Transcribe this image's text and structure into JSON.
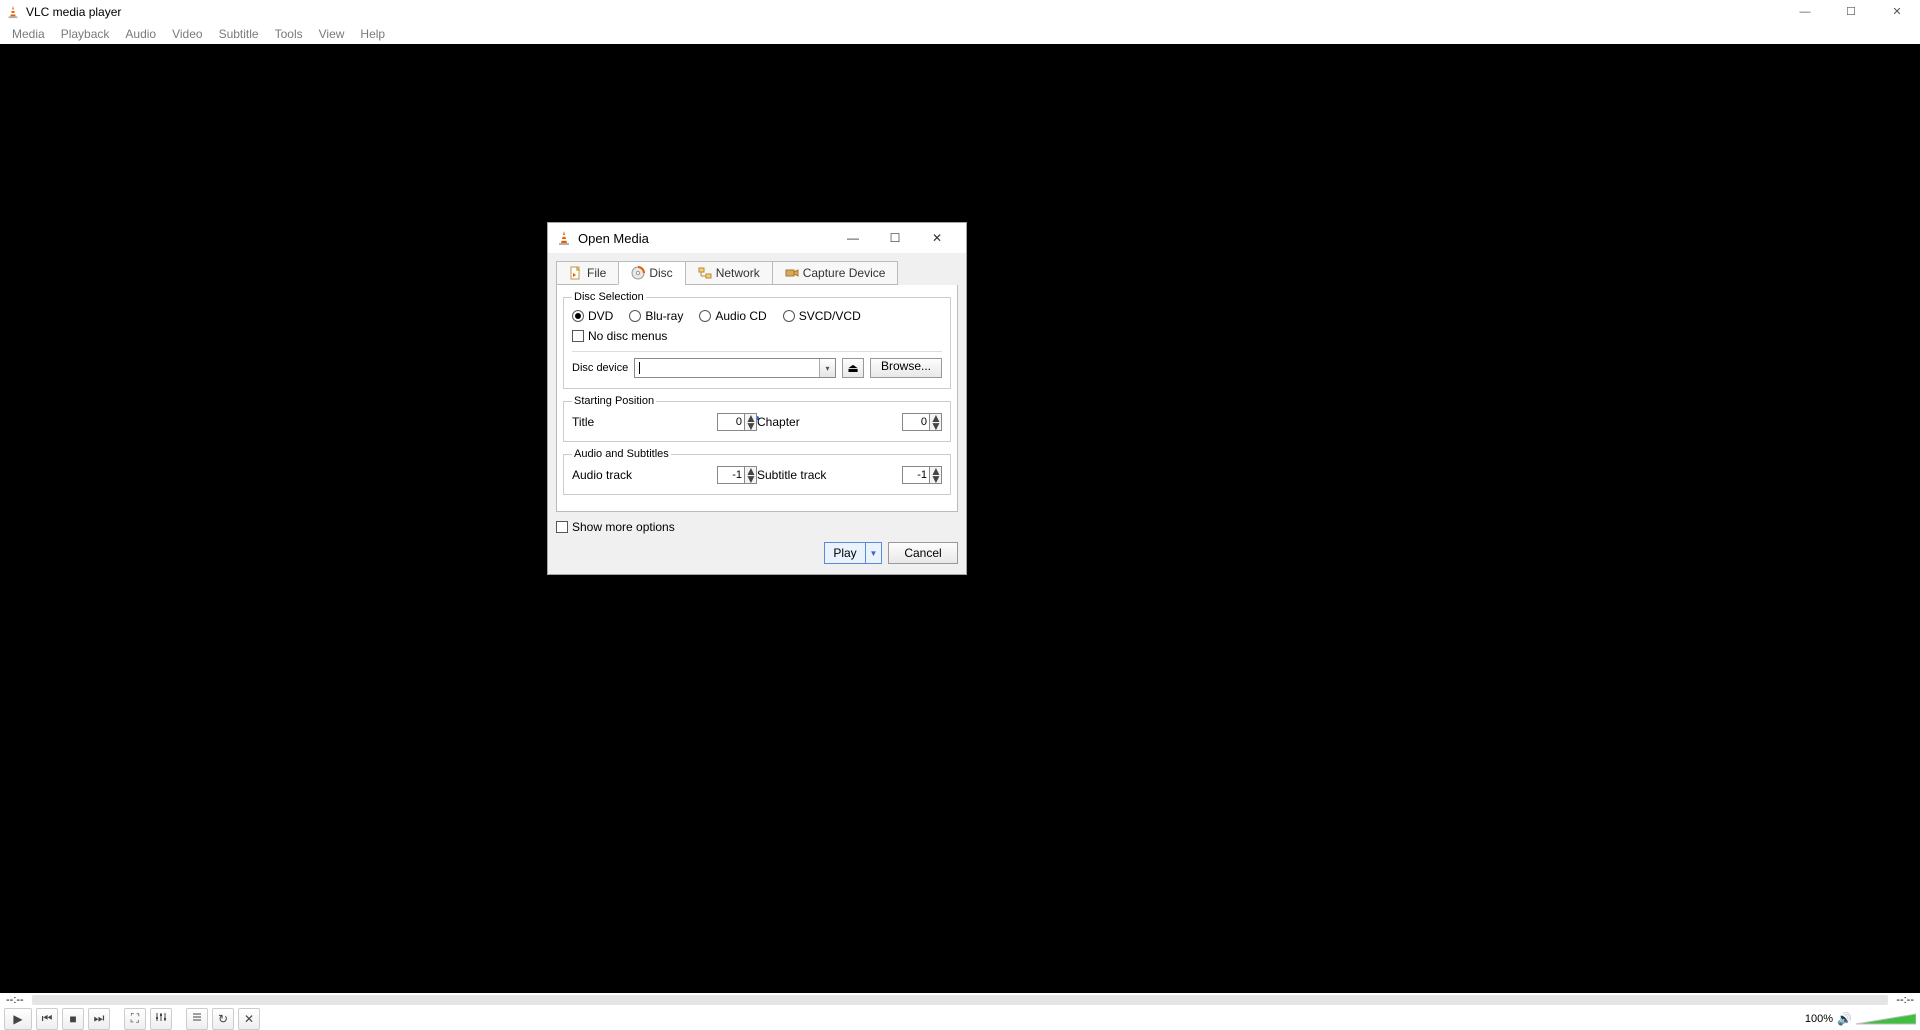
{
  "window": {
    "title": "VLC media player"
  },
  "menu": [
    "Media",
    "Playback",
    "Audio",
    "Video",
    "Subtitle",
    "Tools",
    "View",
    "Help"
  ],
  "seek": {
    "left": "--:--",
    "right": "--:--"
  },
  "volume": {
    "label": "100%"
  },
  "dialog": {
    "title": "Open Media",
    "tabs": {
      "file": "File",
      "disc": "Disc",
      "network": "Network",
      "capture": "Capture Device"
    },
    "disc_selection": {
      "legend": "Disc Selection",
      "dvd": "DVD",
      "bluray": "Blu-ray",
      "audiocd": "Audio CD",
      "svcd": "SVCD/VCD",
      "no_menus": "No disc menus",
      "device_label": "Disc device",
      "device_value": "",
      "browse": "Browse..."
    },
    "starting": {
      "legend": "Starting Position",
      "title_label": "Title",
      "title_value": "0",
      "chapter_label": "Chapter",
      "chapter_value": "0"
    },
    "audiosubs": {
      "legend": "Audio and Subtitles",
      "audio_label": "Audio track",
      "audio_value": "-1",
      "sub_label": "Subtitle track",
      "sub_value": "-1"
    },
    "show_more": "Show more options",
    "play": "Play",
    "cancel": "Cancel"
  }
}
